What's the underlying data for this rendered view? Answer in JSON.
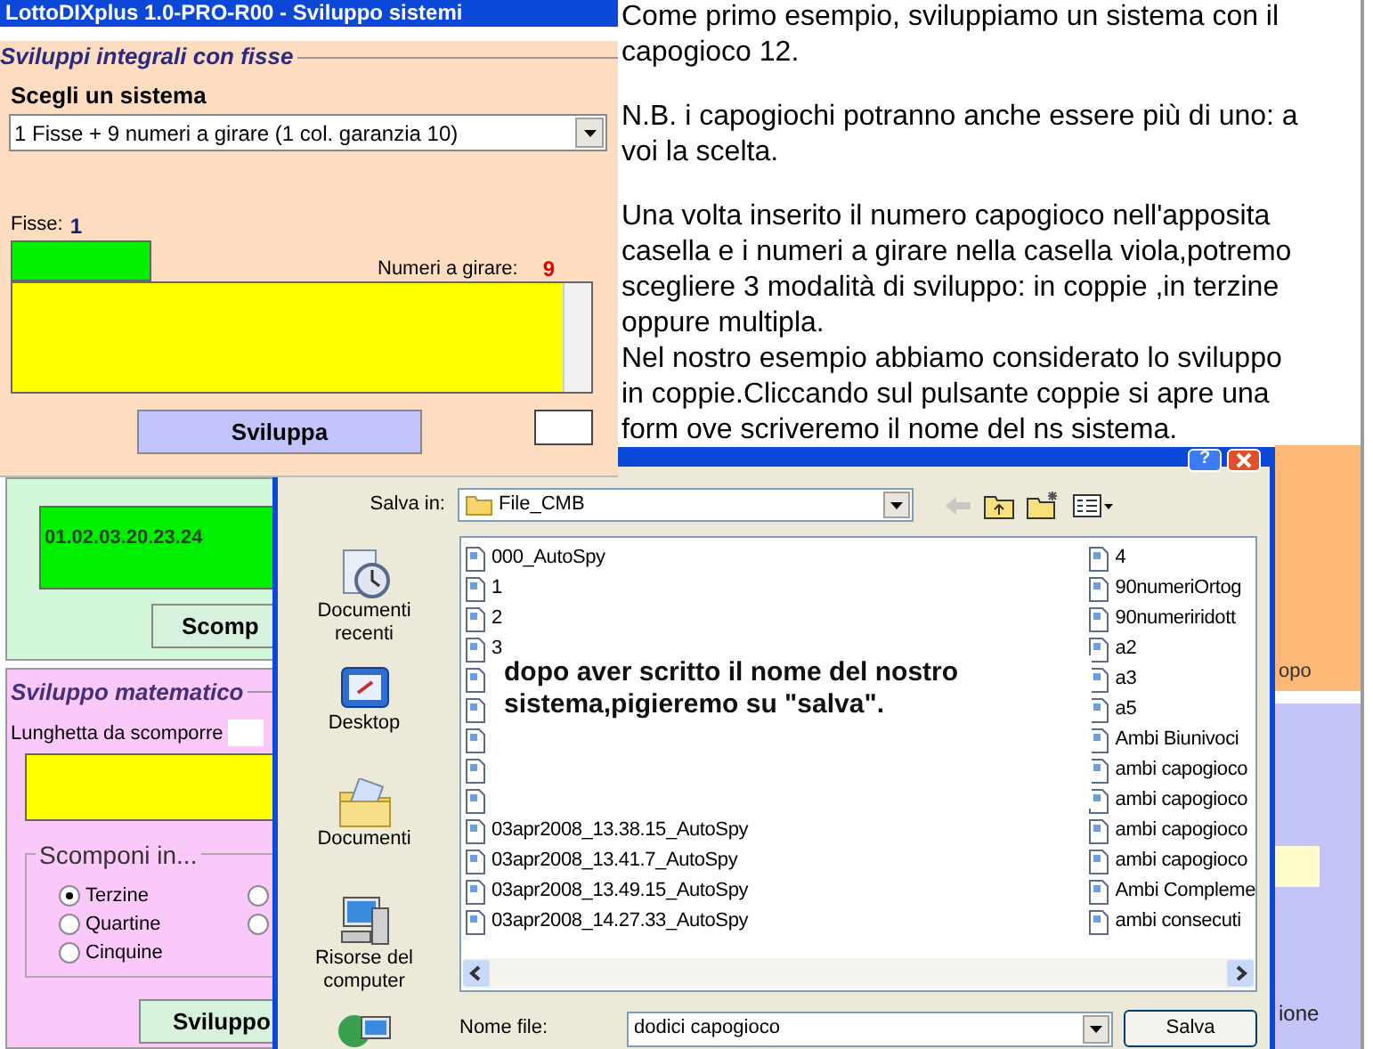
{
  "main_window": {
    "title": "LottoDIXplus 1.0-PRO-R00 - Sviluppo sistemi",
    "group_title": "Sviluppi integrali con fisse",
    "system_label": "Scegli un sistema",
    "system_select": "1 Fisse + 9 numeri a girare (1 col. garanzia 10)",
    "fisse_label": "Fisse:",
    "fisse_value": "1",
    "numeri_label": "Numeri a girare:",
    "numeri_value": "9",
    "button": "Sviluppa"
  },
  "instructions": [
    "Come primo esempio, sviluppiamo un sistema con il\ncapogioco 12.",
    "N.B. i capogiochi potranno anche essere più di uno: a\nvoi la scelta.",
    "Una volta inserito il numero capogioco nell'apposita\ncasella e i numeri a girare nella casella viola,potremo\nscegliere 3 modalità di sviluppo: in coppie ,in terzine\noppure multipla.",
    "Nel nostro esempio abbiamo considerato lo sviluppo\nin coppie.Cliccando sul pulsante coppie si apre una\nform ove scriveremo il nome del ns sistema."
  ],
  "scomposizione_panel": {
    "value": "01.02.03.20.23.24",
    "button": "Scomp"
  },
  "sviluppo_matematico": {
    "title": "Sviluppo matematico",
    "lunghetta_label": "Lunghetta da scomporre",
    "group_title": "Scomponi in...",
    "options": [
      {
        "label": "Terzine",
        "selected": true
      },
      {
        "label": "Quartine",
        "selected": false
      },
      {
        "label": "Cinquine",
        "selected": false
      }
    ],
    "options_column_2": [
      {
        "selected": false
      },
      {
        "selected": false
      }
    ],
    "button": "Sviluppo"
  },
  "save_dialog": {
    "help_button": "?",
    "save_in_label": "Salva in:",
    "folder": "File_CMB",
    "places": [
      {
        "kind": "recent",
        "label": "Documenti recenti"
      },
      {
        "kind": "desktop",
        "label": "Desktop"
      },
      {
        "kind": "documents",
        "label": "Documenti"
      },
      {
        "kind": "computer",
        "label": "Risorse del computer"
      },
      {
        "kind": "network"
      }
    ],
    "files_column_1": [
      {
        "name": "000_AutoSpy"
      },
      {
        "name": "1"
      },
      {
        "name": "2"
      },
      {
        "name": "3"
      },
      {
        "kind": "covered"
      },
      {
        "kind": "covered"
      },
      {
        "kind": "covered"
      },
      {
        "kind": "covered"
      },
      {
        "kind": "covered"
      },
      {
        "name": "03apr2008_13.38.15_AutoSpy"
      },
      {
        "name": "03apr2008_13.41.7_AutoSpy"
      },
      {
        "name": "03apr2008_13.49.15_AutoSpy"
      },
      {
        "name": "03apr2008_14.27.33_AutoSpy"
      }
    ],
    "files_column_2": [
      {
        "name": "4"
      },
      {
        "name": "90numeriOrtog"
      },
      {
        "name": "90numeriridott"
      },
      {
        "name": "a2"
      },
      {
        "name": "a3"
      },
      {
        "name": "a5"
      },
      {
        "name": "Ambi Biunivoci"
      },
      {
        "name": "ambi capogioco"
      },
      {
        "name": "ambi capogioco"
      },
      {
        "name": "ambi capogioco"
      },
      {
        "name": "ambi capogioco"
      },
      {
        "name": "Ambi Compleme"
      },
      {
        "name": "ambi consecuti"
      }
    ],
    "filename_label": "Nome file:",
    "filename": "dodici capogioco",
    "save_button": "Salva"
  },
  "callout": "dopo aver scritto il nome del nostro\nsistema,pigieremo su \"salva\".",
  "background_fragments": {
    "orange_panel_text": "opo",
    "lavender_panel_text": "ione"
  }
}
